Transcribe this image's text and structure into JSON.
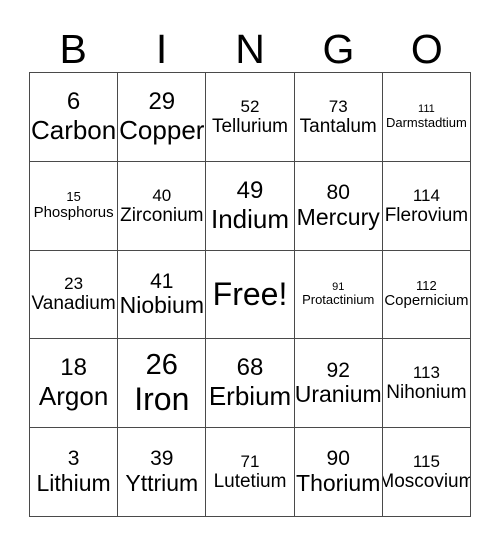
{
  "header": {
    "letters": [
      "B",
      "I",
      "N",
      "G",
      "O"
    ]
  },
  "card": {
    "free_label": "Free!",
    "rows": [
      [
        {
          "number": "6",
          "name": "Carbon"
        },
        {
          "number": "29",
          "name": "Copper"
        },
        {
          "number": "52",
          "name": "Tellurium"
        },
        {
          "number": "73",
          "name": "Tantalum"
        },
        {
          "number": "111",
          "name": "Darmstadtium"
        }
      ],
      [
        {
          "number": "15",
          "name": "Phosphorus"
        },
        {
          "number": "40",
          "name": "Zirconium"
        },
        {
          "number": "49",
          "name": "Indium"
        },
        {
          "number": "80",
          "name": "Mercury"
        },
        {
          "number": "114",
          "name": "Flerovium"
        }
      ],
      [
        {
          "number": "23",
          "name": "Vanadium"
        },
        {
          "number": "41",
          "name": "Niobium"
        },
        {
          "number": "",
          "name": "Free!"
        },
        {
          "number": "91",
          "name": "Protactinium"
        },
        {
          "number": "112",
          "name": "Copernicium"
        }
      ],
      [
        {
          "number": "18",
          "name": "Argon"
        },
        {
          "number": "26",
          "name": "Iron"
        },
        {
          "number": "68",
          "name": "Erbium"
        },
        {
          "number": "92",
          "name": "Uranium"
        },
        {
          "number": "113",
          "name": "Nihonium"
        }
      ],
      [
        {
          "number": "3",
          "name": "Lithium"
        },
        {
          "number": "39",
          "name": "Yttrium"
        },
        {
          "number": "71",
          "name": "Lutetium"
        },
        {
          "number": "90",
          "name": "Thorium"
        },
        {
          "number": "115",
          "name": "Moscovium"
        }
      ]
    ]
  },
  "colors": {
    "background": "#ffffff",
    "text": "#000000",
    "grid_line": "#4a4a4a"
  }
}
